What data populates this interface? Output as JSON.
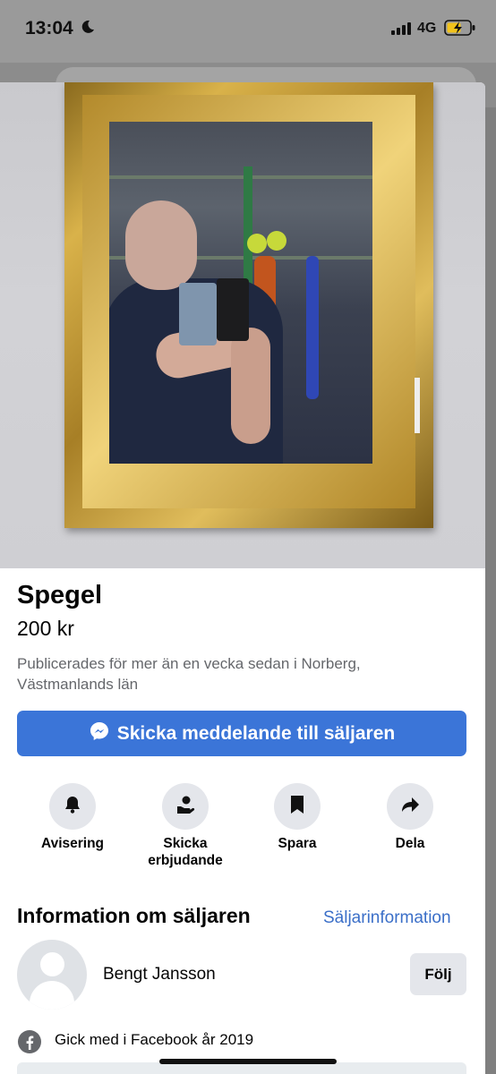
{
  "status_bar": {
    "time": "13:04",
    "network": "4G",
    "moon_icon": "moon-icon",
    "signal_icon": "signal-bars-icon",
    "battery_icon": "battery-charging-icon"
  },
  "listing": {
    "title": "Spegel",
    "price": "200 kr",
    "meta": "Publicerades för mer än en vecka sedan i Norberg, Västmanlands län",
    "photo_alt": "Spegel"
  },
  "message_button": {
    "label": "Skicka meddelande till säljaren",
    "icon": "messenger-icon"
  },
  "actions": [
    {
      "label": "Avisering",
      "icon": "bell-icon"
    },
    {
      "label": "Skicka erbjudande",
      "icon": "offer-icon"
    },
    {
      "label": "Spara",
      "icon": "bookmark-icon"
    },
    {
      "label": "Dela",
      "icon": "share-icon"
    }
  ],
  "seller": {
    "heading": "Information om säljaren",
    "details_link": "Säljarinformation",
    "name": "Bengt Jansson",
    "follow_label": "Följ",
    "joined": "Gick med i Facebook år 2019"
  },
  "colors": {
    "accent": "#3b75d8",
    "link": "#3b6fc8",
    "secondary_text": "#65676b",
    "button_bg": "#e4e6eb"
  }
}
